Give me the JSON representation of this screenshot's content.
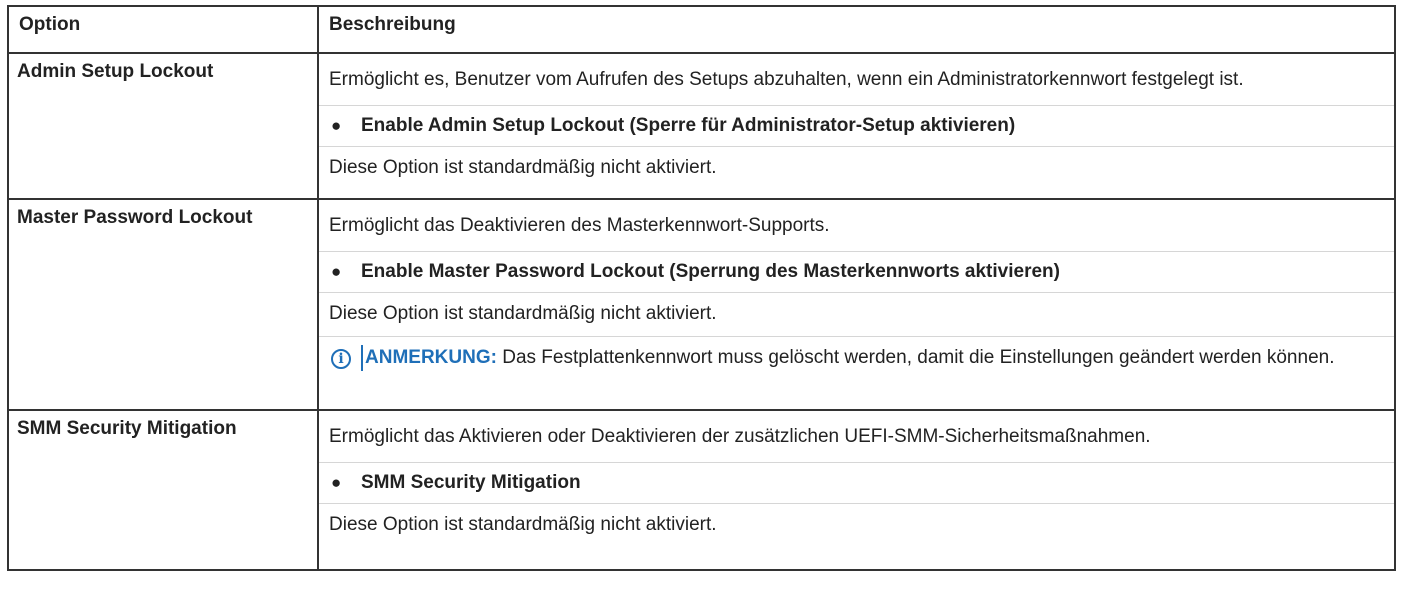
{
  "table": {
    "headers": {
      "option": "Option",
      "description": "Beschreibung"
    },
    "rows": [
      {
        "option": "Admin Setup Lockout",
        "description": "Ermöglicht es, Benutzer vom Aufrufen des Setups abzuhalten, wenn ein Administratorkennwort festgelegt ist.",
        "bullet": "Enable Admin Setup Lockout (Sperre für Administrator-Setup aktivieren)",
        "default": "Diese Option ist standardmäßig nicht aktiviert."
      },
      {
        "option": "Master Password Lockout",
        "description": "Ermöglicht das Deaktivieren des Masterkennwort-Supports.",
        "bullet": "Enable Master Password Lockout (Sperrung des Masterkennworts aktivieren)",
        "default": "Diese Option ist standardmäßig nicht aktiviert.",
        "note_label": "ANMERKUNG:",
        "note_text": " Das Festplattenkennwort muss gelöscht werden, damit die Einstellungen geändert werden können."
      },
      {
        "option": "SMM Security Mitigation",
        "description": "Ermöglicht das Aktivieren oder Deaktivieren der zusätzlichen UEFI-SMM-Sicherheitsmaßnahmen.",
        "bullet": "SMM Security Mitigation",
        "default": "Diese Option ist standardmäßig nicht aktiviert."
      }
    ]
  },
  "icons": {
    "bullet": "●",
    "info": "i",
    "info_icon_name": "info-circle-icon"
  },
  "colors": {
    "note_accent": "#1f6fb8",
    "border": "#333333",
    "text": "#222222"
  }
}
